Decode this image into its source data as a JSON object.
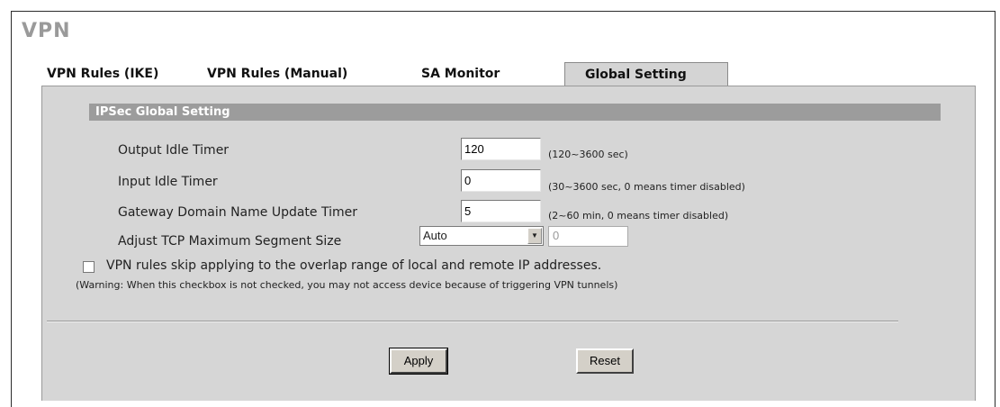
{
  "page": {
    "title": "VPN"
  },
  "tabs": [
    {
      "label": "VPN Rules (IKE)",
      "active": false
    },
    {
      "label": "VPN Rules (Manual)",
      "active": false
    },
    {
      "label": "SA Monitor",
      "active": false
    },
    {
      "label": "Global Setting",
      "active": true
    }
  ],
  "section": {
    "title": "IPSec Global Setting"
  },
  "fields": {
    "output_idle": {
      "label": "Output Idle Timer",
      "value": "120",
      "hint": "(120~3600 sec)"
    },
    "input_idle": {
      "label": "Input Idle Timer",
      "value": "0",
      "hint": "(30~3600 sec, 0 means timer disabled)"
    },
    "gateway_dns": {
      "label": "Gateway Domain Name Update Timer",
      "value": "5",
      "hint": "(2~60 min, 0 means timer disabled)"
    },
    "tcp_mss": {
      "label": "Adjust TCP Maximum Segment Size",
      "selected": "Auto",
      "value": "0"
    }
  },
  "overlap": {
    "checked": false,
    "label": "VPN rules skip applying to the overlap range of local and remote IP addresses.",
    "warning": "(Warning: When this checkbox is not checked, you may not access device because of triggering VPN tunnels)"
  },
  "buttons": {
    "apply": "Apply",
    "reset": "Reset"
  },
  "colors": {
    "panel": "#d6d6d6",
    "section_header": "#9c9c9c",
    "title": "#9a9a9a"
  }
}
